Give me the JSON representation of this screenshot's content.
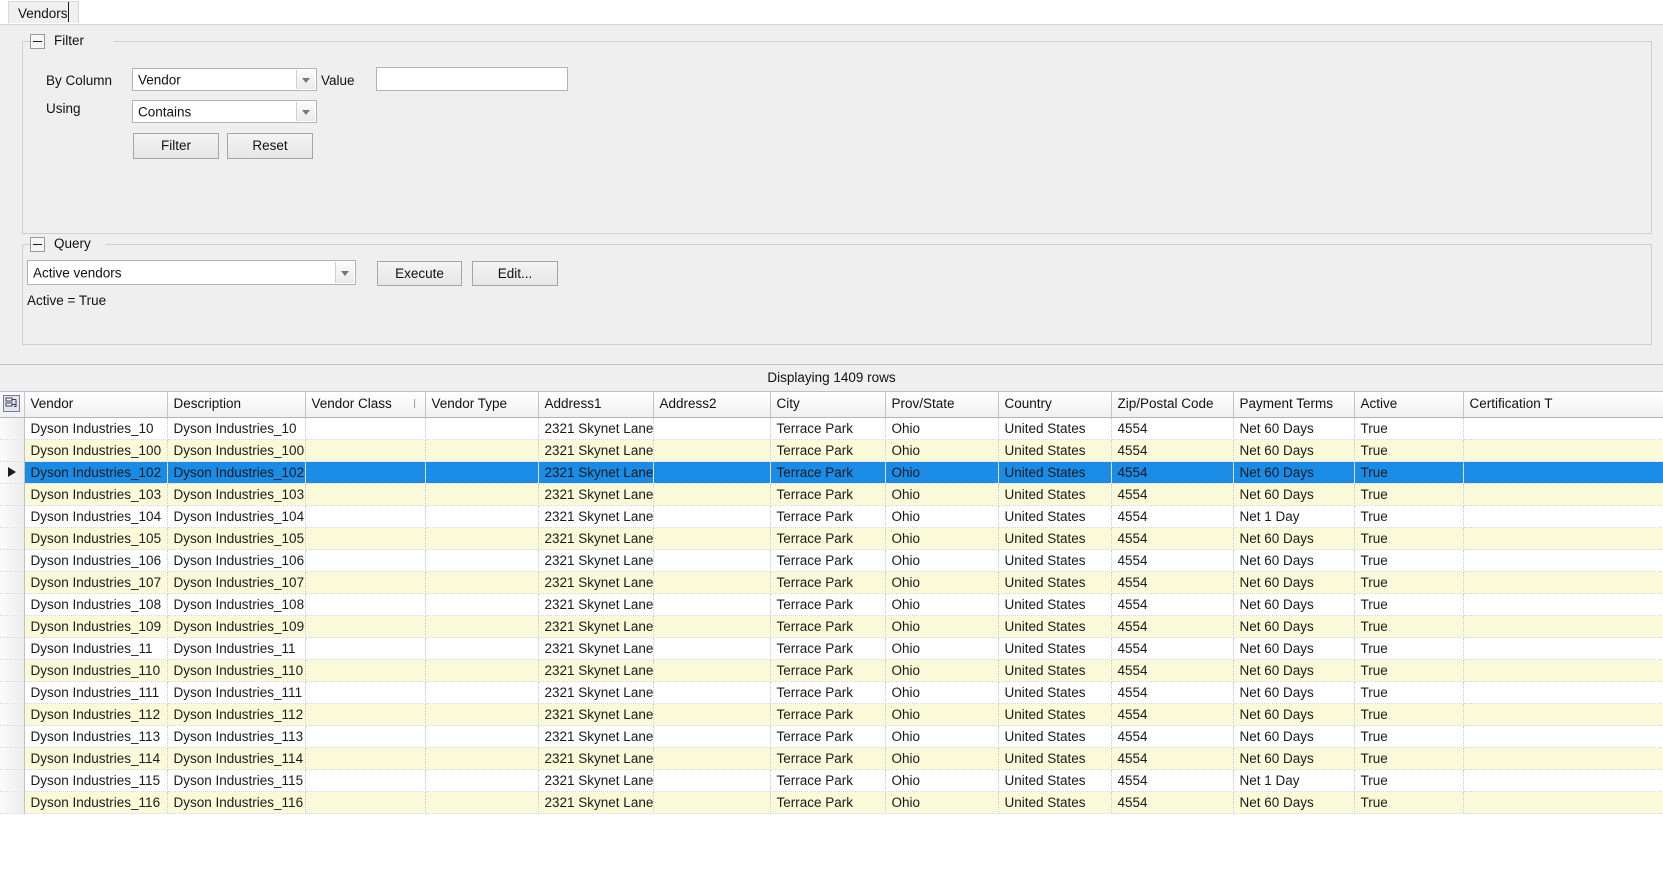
{
  "tab": {
    "label": "Vendors"
  },
  "filter_group": {
    "title": "Filter",
    "by_column_label": "By Column",
    "by_column_value": "Vendor",
    "value_label": "Value",
    "value_text": "",
    "value_placeholder": "",
    "using_label": "Using",
    "using_value": "Contains",
    "filter_button": "Filter",
    "reset_button": "Reset"
  },
  "query_group": {
    "title": "Query",
    "selected_query": "Active vendors",
    "execute_button": "Execute",
    "edit_button": "Edit...",
    "expression": "Active = True"
  },
  "grid": {
    "caption": "Displaying 1409 rows",
    "sort_indicator_column": "Vendor Class",
    "sort_indicator_glyph": "/",
    "columns": [
      "Vendor",
      "Description",
      "Vendor Class",
      "Vendor Type",
      "Address1",
      "Address2",
      "City",
      "Prov/State",
      "Country",
      "Zip/Postal Code",
      "Payment Terms",
      "Active",
      "Certification T"
    ],
    "selected_row_index": 2,
    "rows": [
      [
        "Dyson Industries_10",
        "Dyson Industries_10",
        "",
        "",
        "2321 Skynet Lane",
        "",
        "Terrace Park",
        "Ohio",
        "United States",
        "4554",
        "Net 60 Days",
        "True",
        ""
      ],
      [
        "Dyson Industries_100",
        "Dyson Industries_100",
        "",
        "",
        "2321 Skynet Lane",
        "",
        "Terrace Park",
        "Ohio",
        "United States",
        "4554",
        "Net 60 Days",
        "True",
        ""
      ],
      [
        "Dyson Industries_102",
        "Dyson Industries_102",
        "",
        "",
        "2321 Skynet Lane",
        "",
        "Terrace Park",
        "Ohio",
        "United States",
        "4554",
        "Net 60 Days",
        "True",
        ""
      ],
      [
        "Dyson Industries_103",
        "Dyson Industries_103",
        "",
        "",
        "2321 Skynet Lane",
        "",
        "Terrace Park",
        "Ohio",
        "United States",
        "4554",
        "Net 60 Days",
        "True",
        ""
      ],
      [
        "Dyson Industries_104",
        "Dyson Industries_104",
        "",
        "",
        "2321 Skynet Lane",
        "",
        "Terrace Park",
        "Ohio",
        "United States",
        "4554",
        "Net 1 Day",
        "True",
        ""
      ],
      [
        "Dyson Industries_105",
        "Dyson Industries_105",
        "",
        "",
        "2321 Skynet Lane",
        "",
        "Terrace Park",
        "Ohio",
        "United States",
        "4554",
        "Net 60 Days",
        "True",
        ""
      ],
      [
        "Dyson Industries_106",
        "Dyson Industries_106",
        "",
        "",
        "2321 Skynet Lane",
        "",
        "Terrace Park",
        "Ohio",
        "United States",
        "4554",
        "Net 60 Days",
        "True",
        ""
      ],
      [
        "Dyson Industries_107",
        "Dyson Industries_107",
        "",
        "",
        "2321 Skynet Lane",
        "",
        "Terrace Park",
        "Ohio",
        "United States",
        "4554",
        "Net 60 Days",
        "True",
        ""
      ],
      [
        "Dyson Industries_108",
        "Dyson Industries_108",
        "",
        "",
        "2321 Skynet Lane",
        "",
        "Terrace Park",
        "Ohio",
        "United States",
        "4554",
        "Net 60 Days",
        "True",
        ""
      ],
      [
        "Dyson Industries_109",
        "Dyson Industries_109",
        "",
        "",
        "2321 Skynet Lane",
        "",
        "Terrace Park",
        "Ohio",
        "United States",
        "4554",
        "Net 60 Days",
        "True",
        ""
      ],
      [
        "Dyson Industries_11",
        "Dyson Industries_11",
        "",
        "",
        "2321 Skynet Lane",
        "",
        "Terrace Park",
        "Ohio",
        "United States",
        "4554",
        "Net 60 Days",
        "True",
        ""
      ],
      [
        "Dyson Industries_110",
        "Dyson Industries_110",
        "",
        "",
        "2321 Skynet Lane",
        "",
        "Terrace Park",
        "Ohio",
        "United States",
        "4554",
        "Net 60 Days",
        "True",
        ""
      ],
      [
        "Dyson Industries_111",
        "Dyson Industries_111",
        "",
        "",
        "2321 Skynet Lane",
        "",
        "Terrace Park",
        "Ohio",
        "United States",
        "4554",
        "Net 60 Days",
        "True",
        ""
      ],
      [
        "Dyson Industries_112",
        "Dyson Industries_112",
        "",
        "",
        "2321 Skynet Lane",
        "",
        "Terrace Park",
        "Ohio",
        "United States",
        "4554",
        "Net 60 Days",
        "True",
        ""
      ],
      [
        "Dyson Industries_113",
        "Dyson Industries_113",
        "",
        "",
        "2321 Skynet Lane",
        "",
        "Terrace Park",
        "Ohio",
        "United States",
        "4554",
        "Net 60 Days",
        "True",
        ""
      ],
      [
        "Dyson Industries_114",
        "Dyson Industries_114",
        "",
        "",
        "2321 Skynet Lane",
        "",
        "Terrace Park",
        "Ohio",
        "United States",
        "4554",
        "Net 60 Days",
        "True",
        ""
      ],
      [
        "Dyson Industries_115",
        "Dyson Industries_115",
        "",
        "",
        "2321 Skynet Lane",
        "",
        "Terrace Park",
        "Ohio",
        "United States",
        "4554",
        "Net 1 Day",
        "True",
        ""
      ],
      [
        "Dyson Industries_116",
        "Dyson Industries_116",
        "",
        "",
        "2321 Skynet Lane",
        "",
        "Terrace Park",
        "Ohio",
        "United States",
        "4554",
        "Net 60 Days",
        "True",
        ""
      ]
    ]
  },
  "colors": {
    "selection": "#1a8ce6",
    "alt_row": "#fafad9",
    "panel": "#efefef"
  }
}
